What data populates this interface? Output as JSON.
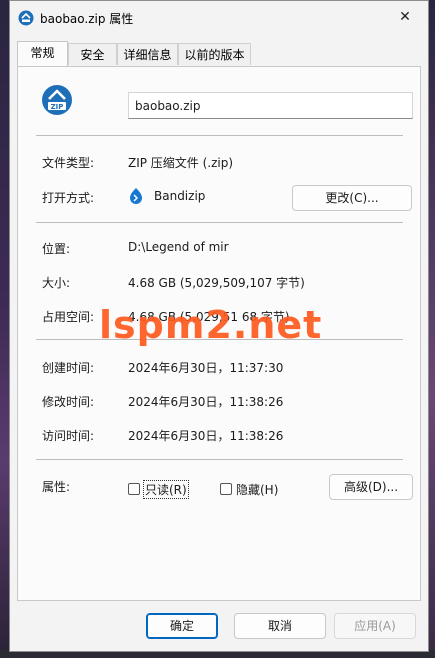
{
  "window": {
    "title": "baobao.zip 属性",
    "close_glyph": "✕"
  },
  "tabs": [
    {
      "label": "常规"
    },
    {
      "label": "安全"
    },
    {
      "label": "详细信息"
    },
    {
      "label": "以前的版本"
    }
  ],
  "general": {
    "file_icon_text": "ZIP",
    "file_name": "baobao.zip",
    "file_type_label": "文件类型:",
    "file_type_value": "ZIP 压缩文件 (.zip)",
    "open_with_label": "打开方式:",
    "open_with_value": "Bandizip",
    "change_button": "更改(C)...",
    "location_label": "位置:",
    "location_value": "D:\\Legend of mir",
    "size_label": "大小:",
    "size_value": "4.68 GB (5,029,509,107 字节)",
    "size_on_disk_label": "占用空间:",
    "size_on_disk_value": "4.68 GB (5,029,51  68 字节)",
    "created_label": "创建时间:",
    "created_value": "2024年6月30日，11:37:30",
    "modified_label": "修改时间:",
    "modified_value": "2024年6月30日，11:38:26",
    "accessed_label": "访问时间:",
    "accessed_value": "2024年6月30日，11:38:26",
    "attributes_label": "属性:",
    "readonly_label": "只读(R)",
    "hidden_label": "隐藏(H)",
    "advanced_button": "高级(D)..."
  },
  "footer": {
    "ok": "确定",
    "cancel": "取消",
    "apply": "应用(A)"
  },
  "watermark": "lspm2.net",
  "colors": {
    "accent": "#0067c0",
    "zip_icon": "#1f6fb8",
    "bandizip_icon": "#1877d2",
    "watermark": "#ff5a1f",
    "disabled_text": "#9a9a9a"
  }
}
